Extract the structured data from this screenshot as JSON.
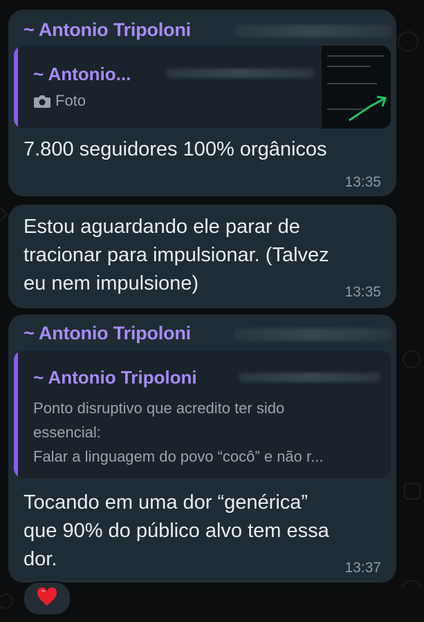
{
  "messages": [
    {
      "sender": "~ Antonio Tripoloni",
      "quote": {
        "sender": "~ Antonio...",
        "media_icon": "camera-icon",
        "media_label": "Foto"
      },
      "text": "7.800 seguidores 100% orgânicos",
      "time": "13:35"
    },
    {
      "text_lines": [
        "Estou aguardando ele parar de",
        "tracionar para impulsionar. (Talvez",
        "eu nem impulsione)"
      ],
      "time": "13:35"
    },
    {
      "sender": "~ Antonio Tripoloni",
      "quote": {
        "sender": "~ Antonio Tripoloni",
        "lines": [
          "Ponto disruptivo que acredito ter sido",
          "essencial:",
          "Falar a linguagem do povo “cocô” e não r..."
        ]
      },
      "text_lines": [
        "Tocando em uma dor “genérica”",
        "que 90% do público alvo tem essa",
        "dor."
      ],
      "time": "13:37"
    }
  ],
  "reaction": {
    "emoji": "❤️",
    "icon": "heart-icon"
  },
  "colors": {
    "background": "#0b0d0e",
    "bubble": "#202c33",
    "quote_bg": "#1a2329",
    "accent": "#a78bfa",
    "time": "#8f9ba3"
  }
}
